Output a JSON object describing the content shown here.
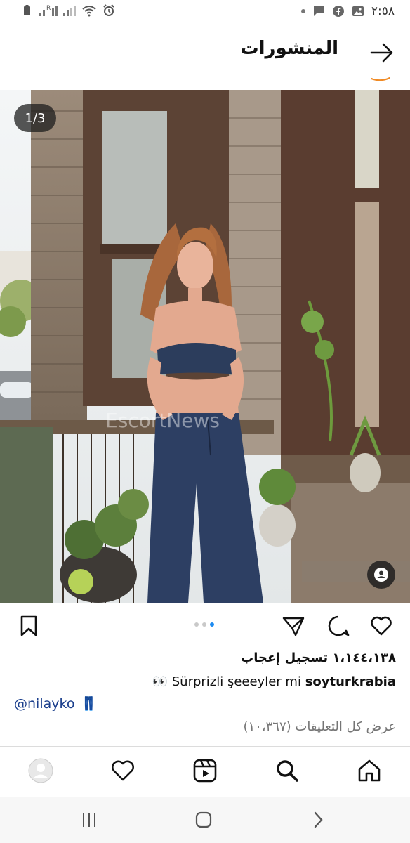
{
  "status_bar": {
    "time": "٢:٥٨",
    "signal_label": "R"
  },
  "header": {
    "title": "المنشورات"
  },
  "post": {
    "image_counter": "1/3",
    "watermark": "EscortNews",
    "likes": "١،١٤٤،١٣٨ تسجيل إعجاب",
    "caption_user": "soyturkrabia",
    "caption_text": "Sürprizli şeeeyler mi",
    "caption_emoji": "👀",
    "mention": "@nilayko",
    "mention_emoji": "👖",
    "view_comments": "عرض كل التعليقات (١٠،٣٦٧)",
    "carousel_dots": 3,
    "carousel_active_index": 2
  },
  "colors": {
    "accent_orange": "#f08a24",
    "active_dot": "#1d8bf1",
    "mention_blue": "#1a3e8c"
  },
  "icons": {
    "back": "arrow-right-icon",
    "bookmark": "bookmark-icon",
    "share": "send-icon",
    "comment": "comment-icon",
    "like": "heart-icon",
    "home": "home-icon",
    "search": "search-icon",
    "reels": "reels-icon",
    "activity": "heart-icon",
    "profile": "avatar-icon"
  }
}
